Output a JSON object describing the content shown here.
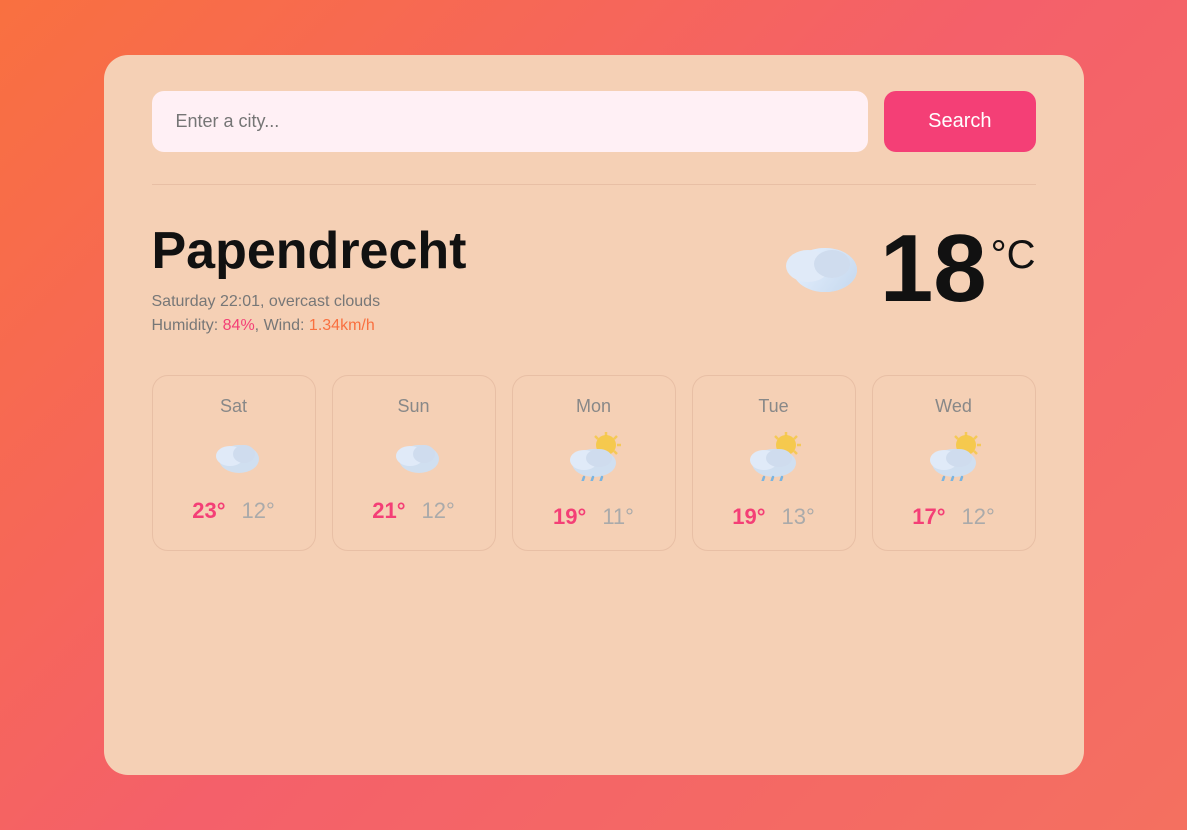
{
  "search": {
    "placeholder": "Enter a city...",
    "button_label": "Search"
  },
  "city": {
    "name": "Papendrecht",
    "datetime": "Saturday 22:01, overcast clouds",
    "humidity_label": "Humidity:",
    "humidity_value": "84%",
    "wind_label": "Wind:",
    "wind_value": "1.34km/h",
    "temperature": "18",
    "degree_unit": "°C",
    "icon": "🌥️"
  },
  "forecast": [
    {
      "day": "Sat",
      "icon": "🌥️",
      "high": "23°",
      "low": "12°"
    },
    {
      "day": "Sun",
      "icon": "🌥️",
      "high": "21°",
      "low": "12°"
    },
    {
      "day": "Mon",
      "icon": "⛅🌧️",
      "high": "19°",
      "low": "11°"
    },
    {
      "day": "Tue",
      "icon": "⛅🌧️",
      "high": "19°",
      "low": "13°"
    },
    {
      "day": "Wed",
      "icon": "⛅🌧️",
      "high": "17°",
      "low": "12°"
    }
  ]
}
